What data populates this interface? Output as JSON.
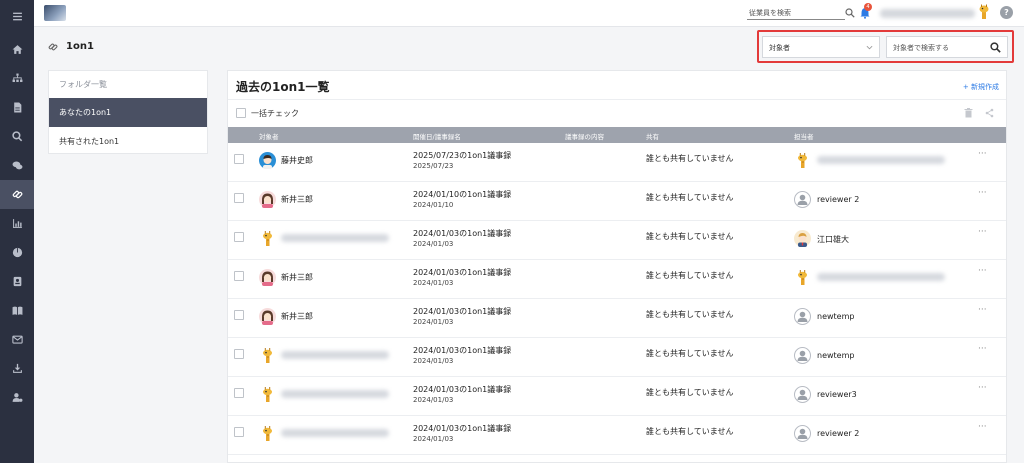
{
  "topbar": {
    "employee_search_placeholder": "従業員を検索",
    "notification_count": "4",
    "help_label": "?"
  },
  "page": {
    "title": "1on1"
  },
  "filter": {
    "target_select": "対象者",
    "search_placeholder": "対象者で検索する"
  },
  "folders": {
    "header": "フォルダ一覧",
    "items": [
      {
        "label": "あなたの1on1",
        "active": true
      },
      {
        "label": "共有された1on1",
        "active": false
      }
    ]
  },
  "main": {
    "title": "過去の1on1一覧",
    "new_button": "+ 新規作成",
    "bulk_check": "一括チェック",
    "columns": [
      "対象者",
      "開催日/議事録名",
      "議事録の内容",
      "共有",
      "担当者"
    ],
    "rows": [
      {
        "target": "藤井史郎",
        "avatar": "boy-b",
        "title": "2025/07/23の1on1議事録",
        "date": "2025/07/23",
        "shared": "誰とも共有していません",
        "responsible": "",
        "res_avatar": "giraffe"
      },
      {
        "target": "新井三郎",
        "avatar": "girl",
        "title": "2024/01/10の1on1議事録",
        "date": "2024/01/10",
        "shared": "誰とも共有していません",
        "responsible": "reviewer 2",
        "res_avatar": "gray"
      },
      {
        "target": "",
        "avatar": "giraffe",
        "title": "2024/01/03の1on1議事録",
        "date": "2024/01/03",
        "shared": "誰とも共有していません",
        "responsible": "江口雄大",
        "res_avatar": "man"
      },
      {
        "target": "新井三郎",
        "avatar": "girl",
        "title": "2024/01/03の1on1議事録",
        "date": "2024/01/03",
        "shared": "誰とも共有していません",
        "responsible": "",
        "res_avatar": "giraffe"
      },
      {
        "target": "新井三郎",
        "avatar": "girl",
        "title": "2024/01/03の1on1議事録",
        "date": "2024/01/03",
        "shared": "誰とも共有していません",
        "responsible": "newtemp",
        "res_avatar": "gray"
      },
      {
        "target": "",
        "avatar": "giraffe",
        "title": "2024/01/03の1on1議事録",
        "date": "2024/01/03",
        "shared": "誰とも共有していません",
        "responsible": "newtemp",
        "res_avatar": "gray"
      },
      {
        "target": "",
        "avatar": "giraffe",
        "title": "2024/01/03の1on1議事録",
        "date": "2024/01/03",
        "shared": "誰とも共有していません",
        "responsible": "reviewer3",
        "res_avatar": "gray"
      },
      {
        "target": "",
        "avatar": "giraffe",
        "title": "2024/01/03の1on1議事録",
        "date": "2024/01/03",
        "shared": "誰とも共有していません",
        "responsible": "reviewer 2",
        "res_avatar": "gray"
      }
    ],
    "row_menu": "···"
  },
  "sidebar": {
    "items": [
      "menu-icon",
      "home-icon",
      "org-chart-icon",
      "document-icon",
      "search-icon",
      "chat-icon",
      "link-icon",
      "chart-icon",
      "pie-icon",
      "profile-card-icon",
      "book-icon",
      "mail-icon",
      "download-icon",
      "user-settings-icon"
    ]
  },
  "colors": {
    "sidebar": "#2b3040",
    "accent": "#2d7be5",
    "highlight": "#e33a3a",
    "table_header": "#9ea3ad"
  }
}
